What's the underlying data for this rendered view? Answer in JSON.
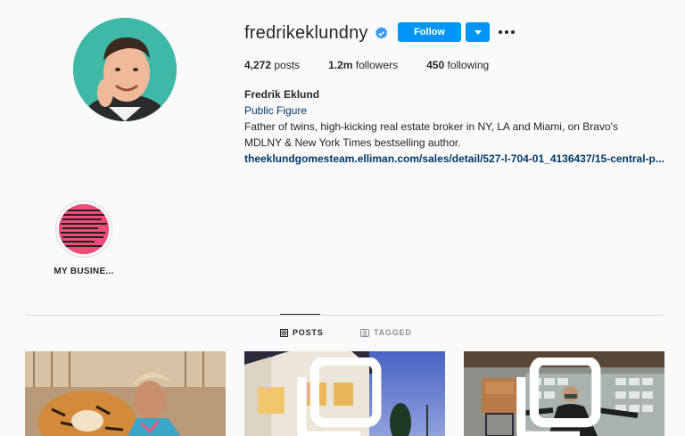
{
  "profile": {
    "username": "fredrikeklundny",
    "verified": true,
    "follow_label": "Follow",
    "stats": {
      "posts_count": "4,272",
      "posts_label": "posts",
      "followers_count": "1.2m",
      "followers_label": "followers",
      "following_count": "450",
      "following_label": "following"
    },
    "full_name": "Fredrik Eklund",
    "category": "Public Figure",
    "bio_line1": "Father of twins, high-kicking real estate broker in NY, LA and Miami, on Bravo's",
    "bio_line2": "MDLNY & New York Times bestselling author.",
    "link": "theeklundgomesteam.elliman.com/sales/detail/527-l-704-01_4136437/15-central-p..."
  },
  "highlights": [
    {
      "label": "MY BUSINE..."
    }
  ],
  "tabs": [
    {
      "label": "POSTS",
      "active": true,
      "icon": "grid-icon"
    },
    {
      "label": "TAGGED",
      "active": false,
      "icon": "tagged-icon"
    }
  ],
  "colors": {
    "accent": "#0095f6",
    "link": "#00376b",
    "background": "#fafafa"
  }
}
